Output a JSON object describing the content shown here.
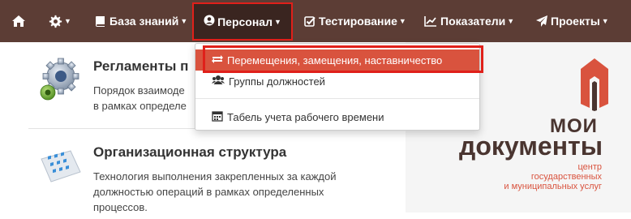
{
  "navbar": {
    "items": [
      {
        "label": "",
        "icon": "home-icon"
      },
      {
        "label": "",
        "icon": "gear-icon"
      },
      {
        "label": "База знаний",
        "icon": "book-icon"
      },
      {
        "label": "Персонал",
        "icon": "user-circle-icon"
      },
      {
        "label": "Тестирование",
        "icon": "checkbox-icon"
      },
      {
        "label": "Показатели",
        "icon": "line-chart-icon"
      },
      {
        "label": "Проекты",
        "icon": "paper-plane-icon"
      }
    ]
  },
  "dropdown": {
    "items": [
      {
        "label": "Перемещения, замещения, наставничество",
        "icon": "exchange-icon",
        "active": true
      },
      {
        "label": "Группы должностей",
        "icon": "users-icon",
        "active": false
      },
      {
        "label": "Табель учета рабочего времени",
        "icon": "calendar-icon",
        "active": false
      }
    ]
  },
  "cards": [
    {
      "title": "Регламенты п",
      "text_lines": [
        "Порядок взаимоде",
        "в рамках определе"
      ],
      "icon": "gears-icon"
    },
    {
      "title": "Организационная структура",
      "text_lines": [
        "Технология выполнения закрепленных за каждой",
        "должностью операций в рамках определенных",
        "процессов."
      ],
      "icon": "org-grid-icon"
    }
  ],
  "logo": {
    "line1": "МОИ",
    "line2": "документы",
    "sub1": "центр",
    "sub2": "государственных",
    "sub3": "и муниципальных услуг",
    "accent_color": "#d9533e",
    "text_color": "#4a3530"
  },
  "colors": {
    "navbar": "#5c3d35",
    "navbar_active": "#3a2520",
    "highlight": "#e0201a",
    "menu_active": "#d9533e"
  }
}
